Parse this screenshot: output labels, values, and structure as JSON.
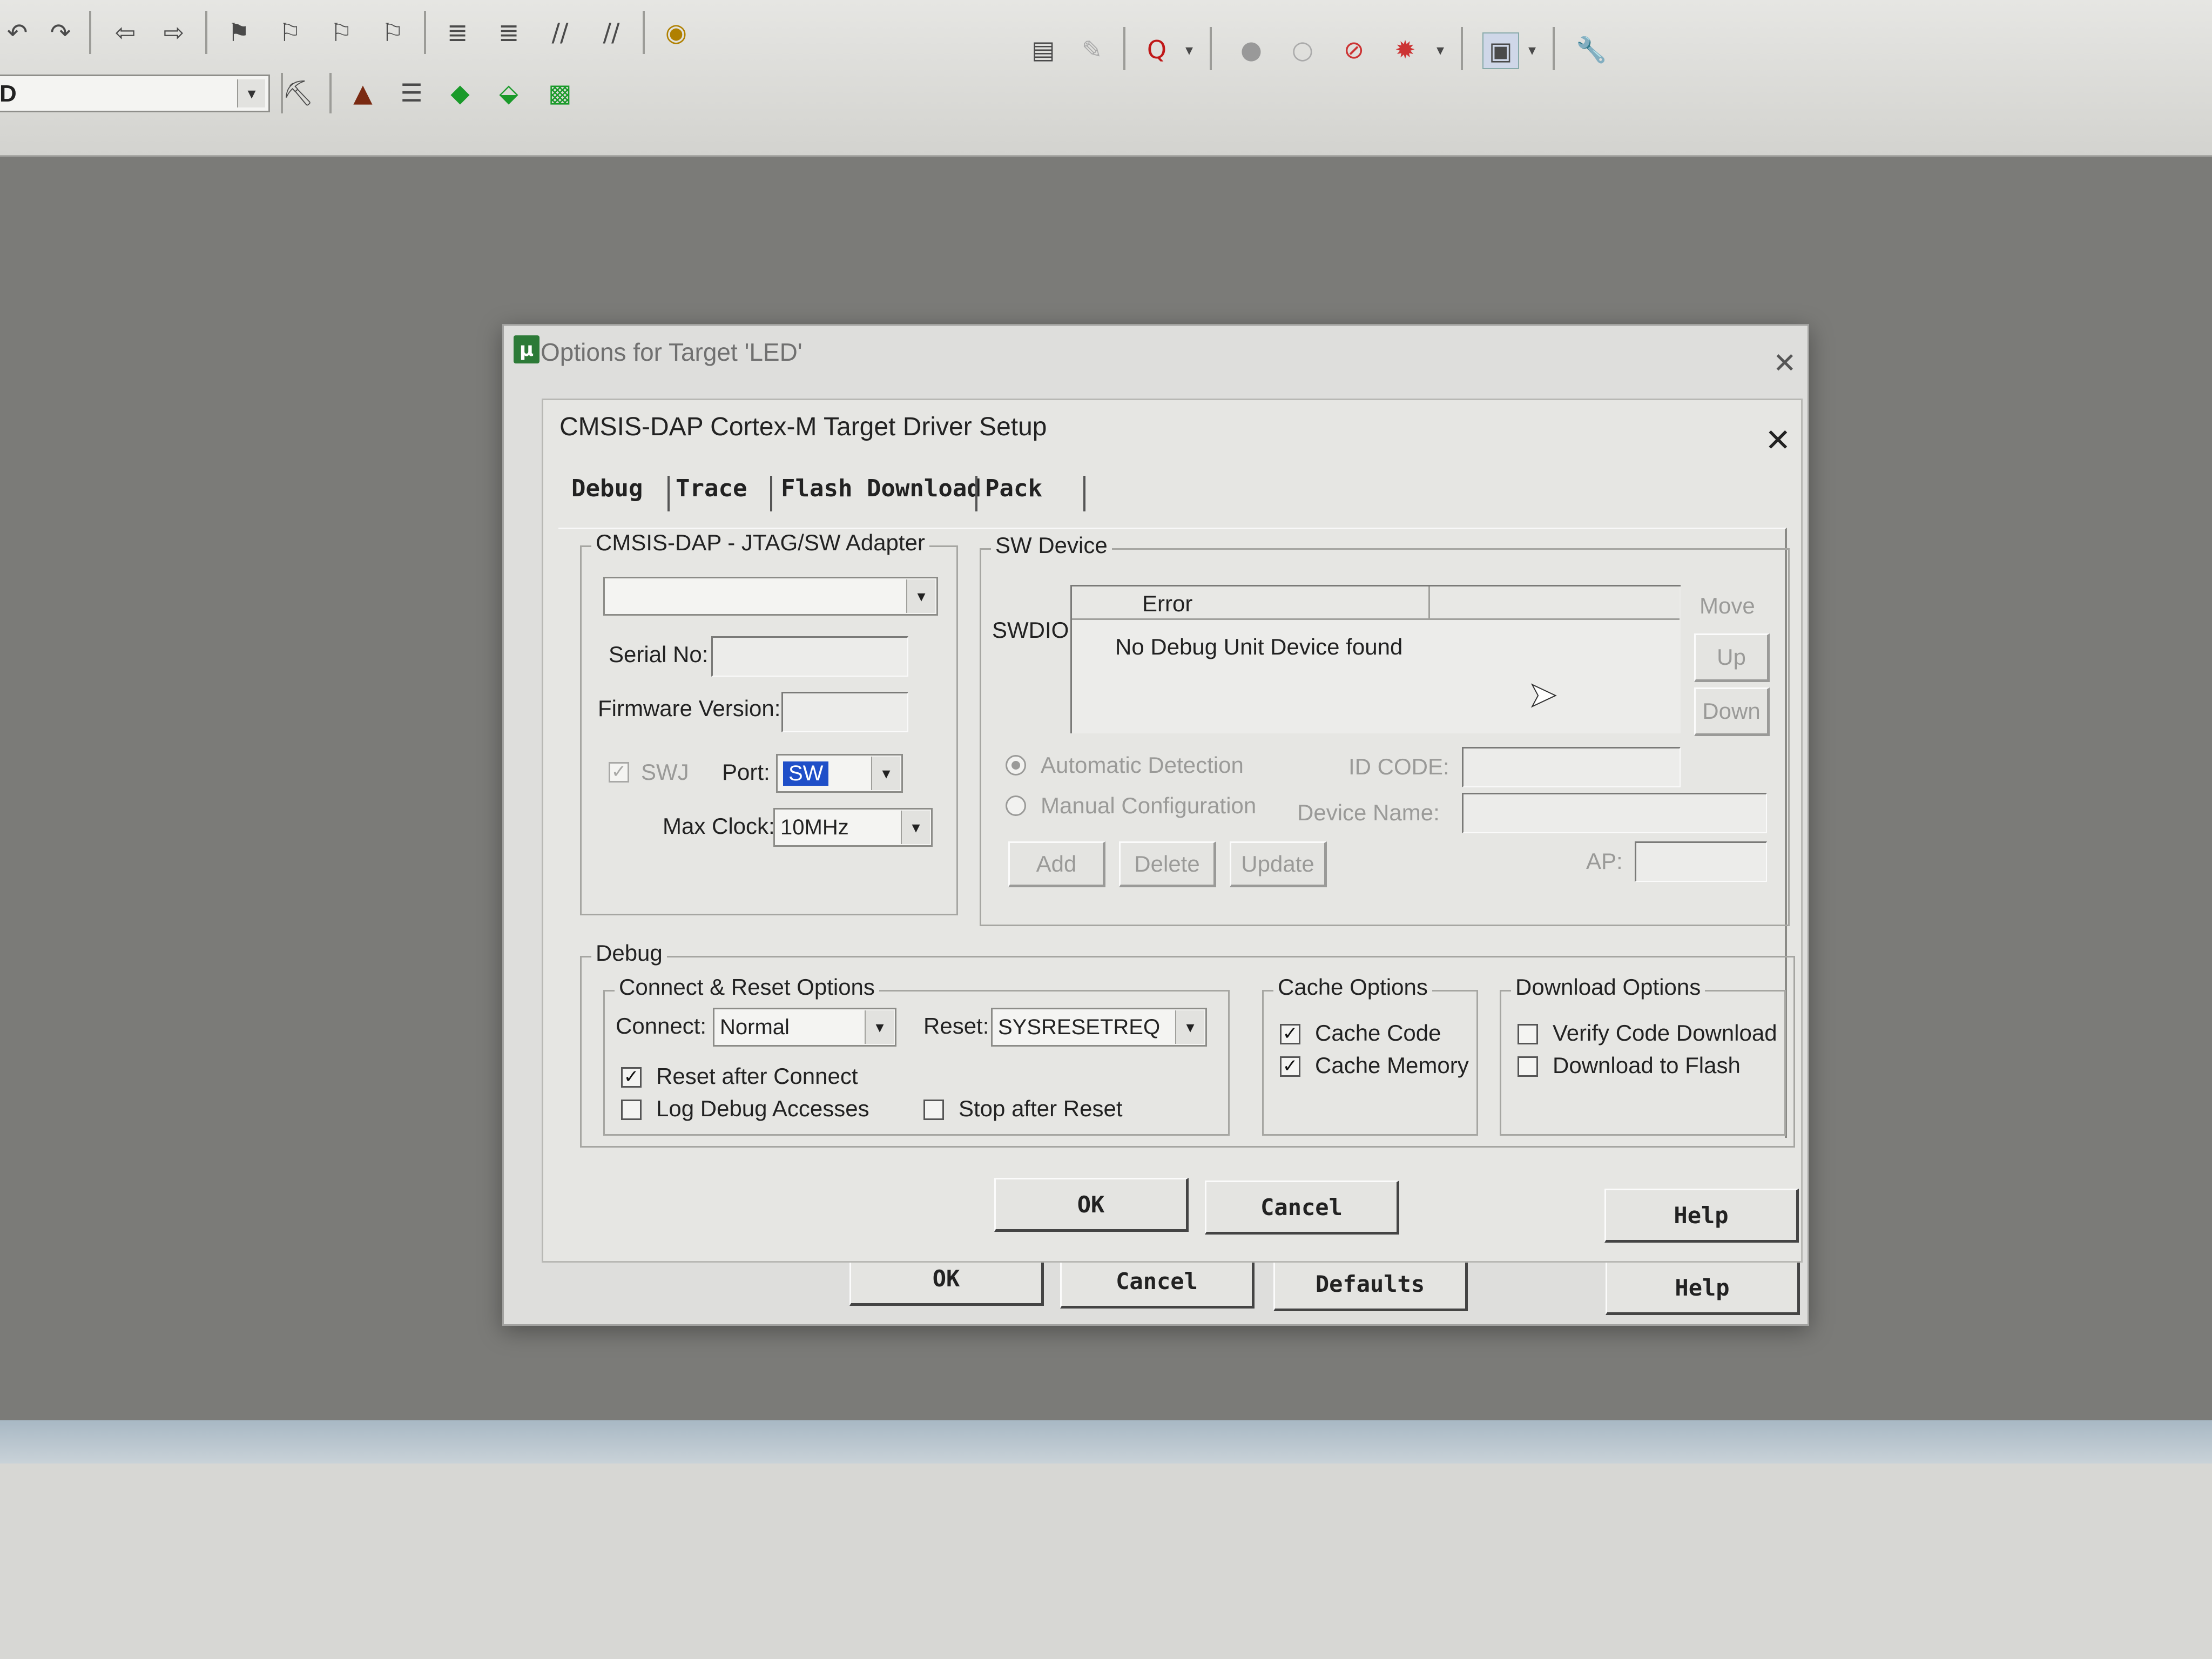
{
  "toolbar": {
    "row1_icons": [
      "undo-icon",
      "redo-icon",
      "nav-back-icon",
      "nav-forward-icon",
      "bookmark-icon",
      "bookmark-prev-icon",
      "bookmark-next-icon",
      "bookmark-clear-icon",
      "indent-icon",
      "unindent-icon",
      "comment-icon",
      "uncomment-icon",
      "find-in-files-icon"
    ],
    "row1_right_icons": [
      "find-icon",
      "replace-icon",
      "debug-session-icon",
      "breakpoint-insert-icon",
      "breakpoint-disable-icon",
      "breakpoint-kill-icon",
      "run-icon",
      "window-layout-icon",
      "configure-icon"
    ],
    "row2_icons": [
      "translate-icon",
      "build-icon",
      "rebuild-icon",
      "batch-build-icon",
      "download-icon",
      "target-options-icon",
      "manage-components-icon"
    ],
    "target_value": "D"
  },
  "outer_dialog": {
    "title": "Options for Target 'LED'",
    "buttons": {
      "ok": "OK",
      "cancel": "Cancel",
      "defaults": "Defaults",
      "help": "Help"
    }
  },
  "inner_dialog": {
    "title": "CMSIS-DAP Cortex-M Target Driver Setup",
    "tabs": [
      "Debug",
      "Trace",
      "Flash Download",
      "Pack"
    ],
    "adapter": {
      "group_title": "CMSIS-DAP - JTAG/SW Adapter",
      "adapter_value": "",
      "serial_label": "Serial No:",
      "serial_value": "",
      "firmware_label": "Firmware Version:",
      "firmware_value": "",
      "swj_label": "SWJ",
      "swj_checked": true,
      "port_label": "Port:",
      "port_value": "SW",
      "max_clock_label": "Max Clock:",
      "max_clock_value": "10MHz"
    },
    "sw_device": {
      "group_title": "SW Device",
      "swdio_label": "SWDIO",
      "column_header": "Error",
      "row_text": "No Debug Unit Device found",
      "move_label": "Move",
      "up_label": "Up",
      "down_label": "Down",
      "auto_detect_label": "Automatic Detection",
      "manual_config_label": "Manual Configuration",
      "selected_mode": "Automatic Detection",
      "id_code_label": "ID CODE:",
      "device_name_label": "Device Name:",
      "ap_label": "AP:",
      "add_label": "Add",
      "delete_label": "Delete",
      "update_label": "Update"
    },
    "debug": {
      "group_title": "Debug",
      "connect_reset": {
        "group_title": "Connect & Reset Options",
        "connect_label": "Connect:",
        "connect_value": "Normal",
        "reset_label": "Reset:",
        "reset_value": "SYSRESETREQ",
        "reset_after_connect_label": "Reset after Connect",
        "reset_after_connect_checked": true,
        "log_debug_label": "Log Debug Accesses",
        "log_debug_checked": false,
        "stop_after_reset_label": "Stop after Reset",
        "stop_after_reset_checked": false
      },
      "cache": {
        "group_title": "Cache Options",
        "cache_code_label": "Cache Code",
        "cache_code_checked": true,
        "cache_memory_label": "Cache Memory",
        "cache_memory_checked": true
      },
      "download": {
        "group_title": "Download Options",
        "verify_label": "Verify Code Download",
        "verify_checked": false,
        "flash_label": "Download to Flash",
        "flash_checked": false
      }
    },
    "buttons": {
      "ok": "OK",
      "cancel": "Cancel",
      "help": "Help"
    }
  },
  "colors": {
    "dialog_bg": "#e6e6e3",
    "selection_blue": "#1f4fc8",
    "disabled_text": "#9a9a98"
  }
}
